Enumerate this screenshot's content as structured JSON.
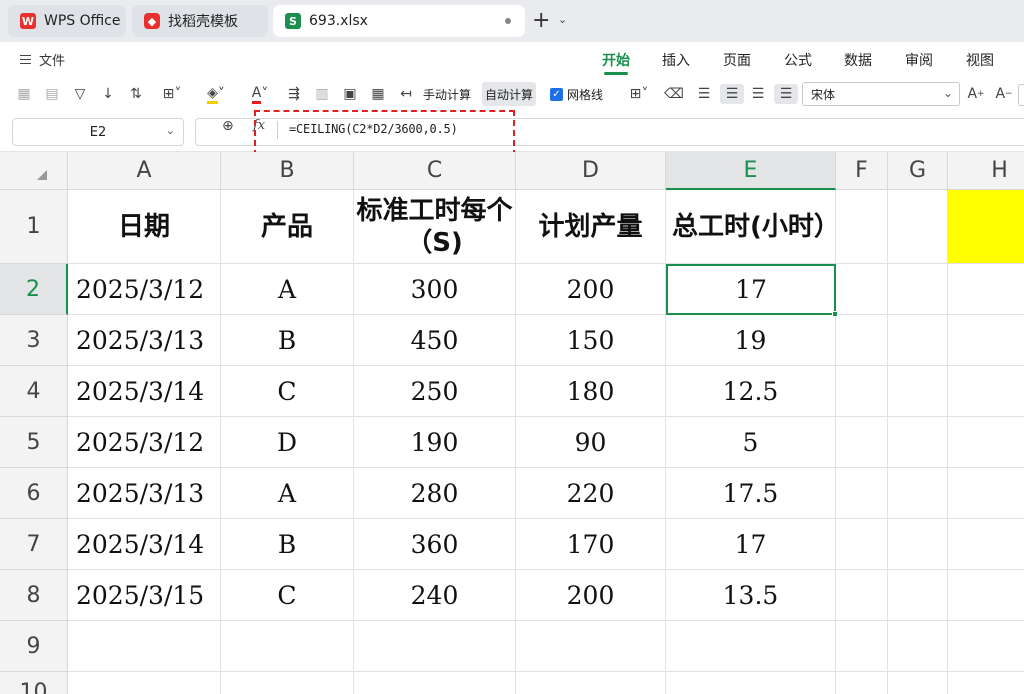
{
  "tabs": [
    {
      "label": "WPS Office",
      "icon": "wps-logo-icon",
      "active": false
    },
    {
      "label": "找稻壳模板",
      "icon": "docer-icon",
      "active": false
    },
    {
      "label": "693.xlsx",
      "icon": "sheet-icon",
      "icon_letter": "S",
      "active": true
    }
  ],
  "menu": {
    "file_label": "文件",
    "ribbon_tabs": [
      "开始",
      "插入",
      "页面",
      "公式",
      "数据",
      "审阅",
      "视图"
    ],
    "active_tab": "开始"
  },
  "toolbar": {
    "manual_calc": "手动计算",
    "auto_calc": "自动计算",
    "gridlines": "网格线",
    "gridlines_checked": true,
    "font_name": "宋体"
  },
  "formula_bar": {
    "cell_ref": "E2",
    "formula": "=CEILING(C2*D2/3600,0.5)"
  },
  "sheet": {
    "columns": [
      "A",
      "B",
      "C",
      "D",
      "E",
      "F",
      "G",
      "H"
    ],
    "selected_column": "E",
    "rows": [
      "1",
      "2",
      "3",
      "4",
      "5",
      "6",
      "7",
      "8",
      "9",
      "10"
    ],
    "selected_row": "2",
    "header": [
      "日期",
      "产品",
      "标准工时每个（S)",
      "计划产量",
      "总工时(小时）"
    ],
    "data": [
      [
        "2025/3/12",
        "A",
        "300",
        "200",
        "17"
      ],
      [
        "2025/3/13",
        "B",
        "450",
        "150",
        "19"
      ],
      [
        "2025/3/14",
        "C",
        "250",
        "180",
        "12.5"
      ],
      [
        "2025/3/12",
        "D",
        "190",
        "90",
        "5"
      ],
      [
        "2025/3/13",
        "A",
        "280",
        "220",
        "17.5"
      ],
      [
        "2025/3/14",
        "B",
        "360",
        "170",
        "17"
      ],
      [
        "2025/3/15",
        "C",
        "240",
        "200",
        "13.5"
      ]
    ],
    "highlight_color": "#ffff00",
    "accent_color": "#1a8f4e"
  }
}
